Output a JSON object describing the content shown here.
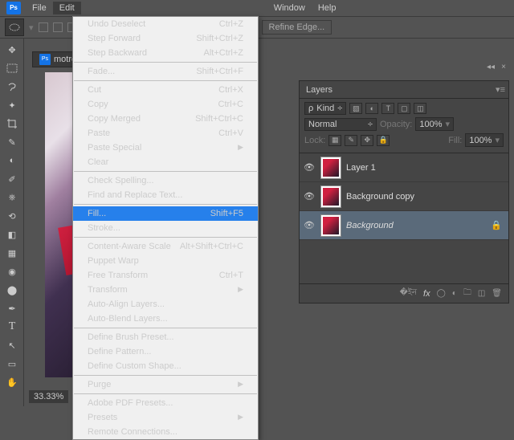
{
  "menubar": {
    "items": [
      "File",
      "Edit",
      "",
      "",
      "",
      "",
      "",
      "",
      "Window",
      "Help"
    ]
  },
  "toolbar": {
    "refine": "Refine Edge..."
  },
  "doc": {
    "name": "motret",
    "zoom": "33.33%"
  },
  "dropdown": [
    {
      "label": "Undo Deselect",
      "shortcut": "Ctrl+Z"
    },
    {
      "label": "Step Forward",
      "shortcut": "Shift+Ctrl+Z"
    },
    {
      "label": "Step Backward",
      "shortcut": "Alt+Ctrl+Z"
    },
    {
      "sep": true
    },
    {
      "label": "Fade...",
      "shortcut": "Shift+Ctrl+F",
      "disabled": true
    },
    {
      "sep": true
    },
    {
      "label": "Cut",
      "shortcut": "Ctrl+X"
    },
    {
      "label": "Copy",
      "shortcut": "Ctrl+C"
    },
    {
      "label": "Copy Merged",
      "shortcut": "Shift+Ctrl+C"
    },
    {
      "label": "Paste",
      "shortcut": "Ctrl+V"
    },
    {
      "label": "Paste Special",
      "sub": true
    },
    {
      "label": "Clear"
    },
    {
      "sep": true
    },
    {
      "label": "Check Spelling..."
    },
    {
      "label": "Find and Replace Text..."
    },
    {
      "sep": true
    },
    {
      "label": "Fill...",
      "shortcut": "Shift+F5",
      "selected": true
    },
    {
      "label": "Stroke..."
    },
    {
      "sep": true
    },
    {
      "label": "Content-Aware Scale",
      "shortcut": "Alt+Shift+Ctrl+C"
    },
    {
      "label": "Puppet Warp"
    },
    {
      "label": "Free Transform",
      "shortcut": "Ctrl+T"
    },
    {
      "label": "Transform",
      "sub": true
    },
    {
      "label": "Auto-Align Layers...",
      "disabled": true
    },
    {
      "label": "Auto-Blend Layers...",
      "disabled": true
    },
    {
      "sep": true
    },
    {
      "label": "Define Brush Preset..."
    },
    {
      "label": "Define Pattern..."
    },
    {
      "label": "Define Custom Shape...",
      "disabled": true
    },
    {
      "sep": true
    },
    {
      "label": "Purge",
      "sub": true
    },
    {
      "sep": true
    },
    {
      "label": "Adobe PDF Presets..."
    },
    {
      "label": "Presets",
      "sub": true
    },
    {
      "label": "Remote Connections..."
    }
  ],
  "layers": {
    "title": "Layers",
    "kind": "Kind",
    "mode": "Normal",
    "opacity_lbl": "Opacity:",
    "opacity": "100%",
    "lock_lbl": "Lock:",
    "fill_lbl": "Fill:",
    "fill": "100%",
    "items": [
      {
        "name": "Layer 1"
      },
      {
        "name": "Background copy"
      },
      {
        "name": "Background",
        "locked": true,
        "selected": true,
        "italic": true
      }
    ]
  }
}
